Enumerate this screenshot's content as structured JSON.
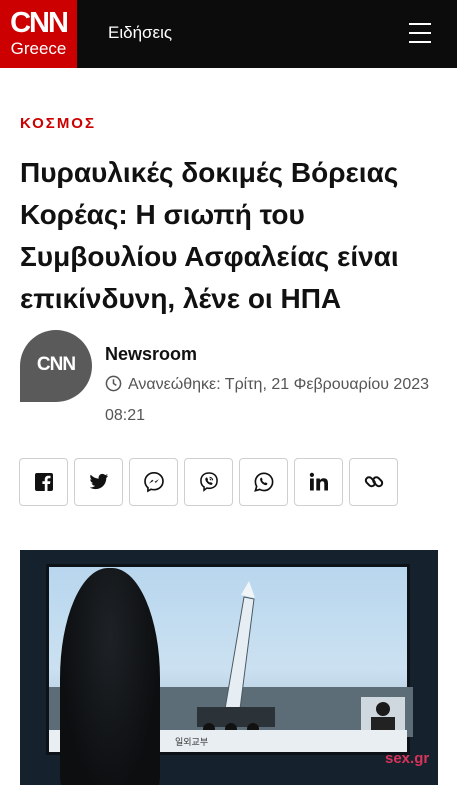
{
  "header": {
    "logo_main": "CNN",
    "logo_sub": "Greece",
    "nav_label": "Ειδήσεις",
    "menu_icon": "hamburger-menu-icon"
  },
  "article": {
    "section": "ΚΟΣΜΟΣ",
    "headline": "Πυραυλικές δοκιμές Βόρειας Κορέας: Η σιωπή του Συμβουλίου Ασφαλείας είναι επικίνδυνη, λένε οι ΗΠΑ",
    "author": "Newsroom",
    "avatar_text": "CNN",
    "updated": "Ανανεώθηκε: Τρίτη, 21 Φεβρουαρίου 2023 08:21"
  },
  "share": {
    "buttons": [
      "facebook-icon",
      "twitter-icon",
      "messenger-icon",
      "viber-icon",
      "whatsapp-icon",
      "linkedin-icon",
      "link-icon"
    ]
  },
  "image": {
    "caption_text": "일외교부",
    "watermark": "sex.gr"
  },
  "colors": {
    "brand_red": "#cc0000",
    "header_bg": "#0c0c0c",
    "text": "#111111"
  }
}
